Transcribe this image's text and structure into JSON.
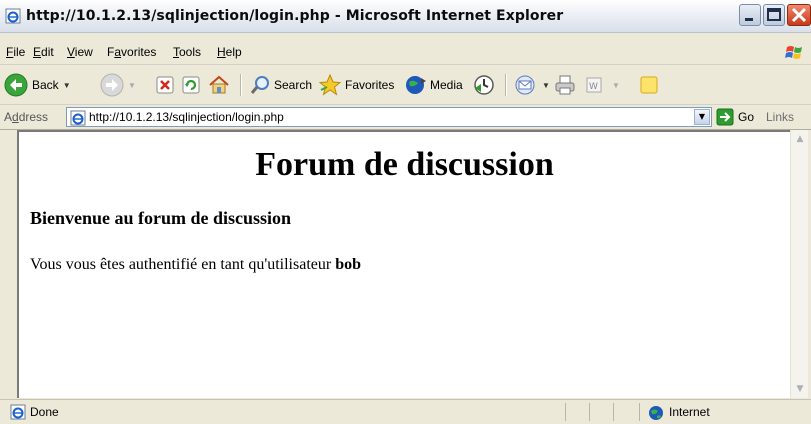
{
  "window": {
    "title": "http://10.1.2.13/sqlinjection/login.php - Microsoft Internet Explorer"
  },
  "menu": {
    "items": [
      {
        "pre": "",
        "key": "F",
        "post": "ile"
      },
      {
        "pre": "",
        "key": "E",
        "post": "dit"
      },
      {
        "pre": "",
        "key": "V",
        "post": "iew"
      },
      {
        "pre": "F",
        "key": "a",
        "post": "vorites"
      },
      {
        "pre": "",
        "key": "T",
        "post": "ools"
      },
      {
        "pre": "",
        "key": "H",
        "post": "elp"
      }
    ]
  },
  "toolbar": {
    "back_label": "Back",
    "search_label": "Search",
    "favorites_label": "Favorites",
    "media_label": "Media"
  },
  "address": {
    "label_pre": "A",
    "label_key": "d",
    "label_post": "dress",
    "url": "http://10.1.2.13/sqlinjection/login.php",
    "go_label": "Go",
    "links_label": "Links"
  },
  "page": {
    "heading": "Forum de discussion",
    "subheading": "Bienvenue au forum de discussion",
    "message_prefix": "Vous vous êtes authentifié en tant qu'utilisateur ",
    "username": "bob"
  },
  "status": {
    "text": "Done",
    "zone": "Internet"
  },
  "colors": {
    "chrome_bg": "#ece9d8",
    "close_button": "#c8391a",
    "go_arrow": "#2f9a2f"
  }
}
